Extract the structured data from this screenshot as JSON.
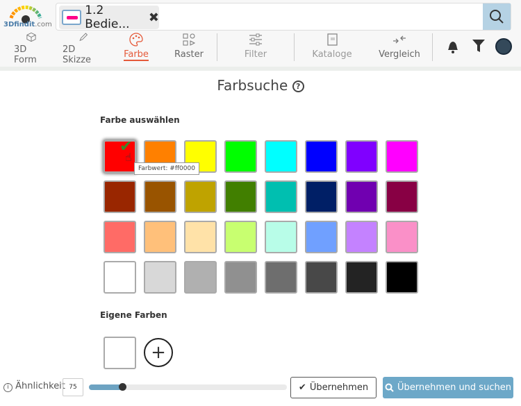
{
  "header": {
    "logo_main": "3Dfindit",
    "logo_suffix": ".com",
    "search_chip": "1.2 Bedie...",
    "search_value": ""
  },
  "nav": [
    {
      "label": "3D Form"
    },
    {
      "label": "2D Skizze"
    },
    {
      "label": "Farbe",
      "active": true
    },
    {
      "label": "Raster"
    },
    {
      "label": "Filter"
    },
    {
      "label": "Kataloge"
    },
    {
      "label": "Vergleich"
    }
  ],
  "main": {
    "title": "Farbsuche",
    "help": "?",
    "select_heading": "Farbe auswählen",
    "tooltip": "Farbwert: #ff0000",
    "selected": "#ff0000",
    "swatches": [
      [
        "#ff0000",
        "#ff8000",
        "#ffff00",
        "#00ff00",
        "#00ffff",
        "#0000ff",
        "#8000ff",
        "#ff00ff"
      ],
      [
        "#992600",
        "#995400",
        "#bfa300",
        "#417f00",
        "#00bfb0",
        "#001f66",
        "#7000b0",
        "#880044"
      ],
      [
        "#ff6b66",
        "#ffc07a",
        "#ffe2a8",
        "#c8ff70",
        "#b8fde8",
        "#70a0ff",
        "#c482ff",
        "#fa90c8"
      ],
      [
        "#ffffff",
        "#d8d8d8",
        "#b0b0b0",
        "#909090",
        "#6e6e6e",
        "#484848",
        "#232323",
        "#000000"
      ]
    ],
    "own_heading": "Eigene Farben",
    "own_colors": [
      "#ffffff"
    ],
    "add": "+"
  },
  "footer": {
    "similarity_label": "Ähnlichkeit",
    "similarity_value": "75",
    "slider_fraction": 0.17,
    "apply": "Übernehmen",
    "apply_search": "Übernehmen und suchen"
  },
  "colors": {
    "accent": "#e55a3a",
    "primary": "#6da8c8"
  }
}
